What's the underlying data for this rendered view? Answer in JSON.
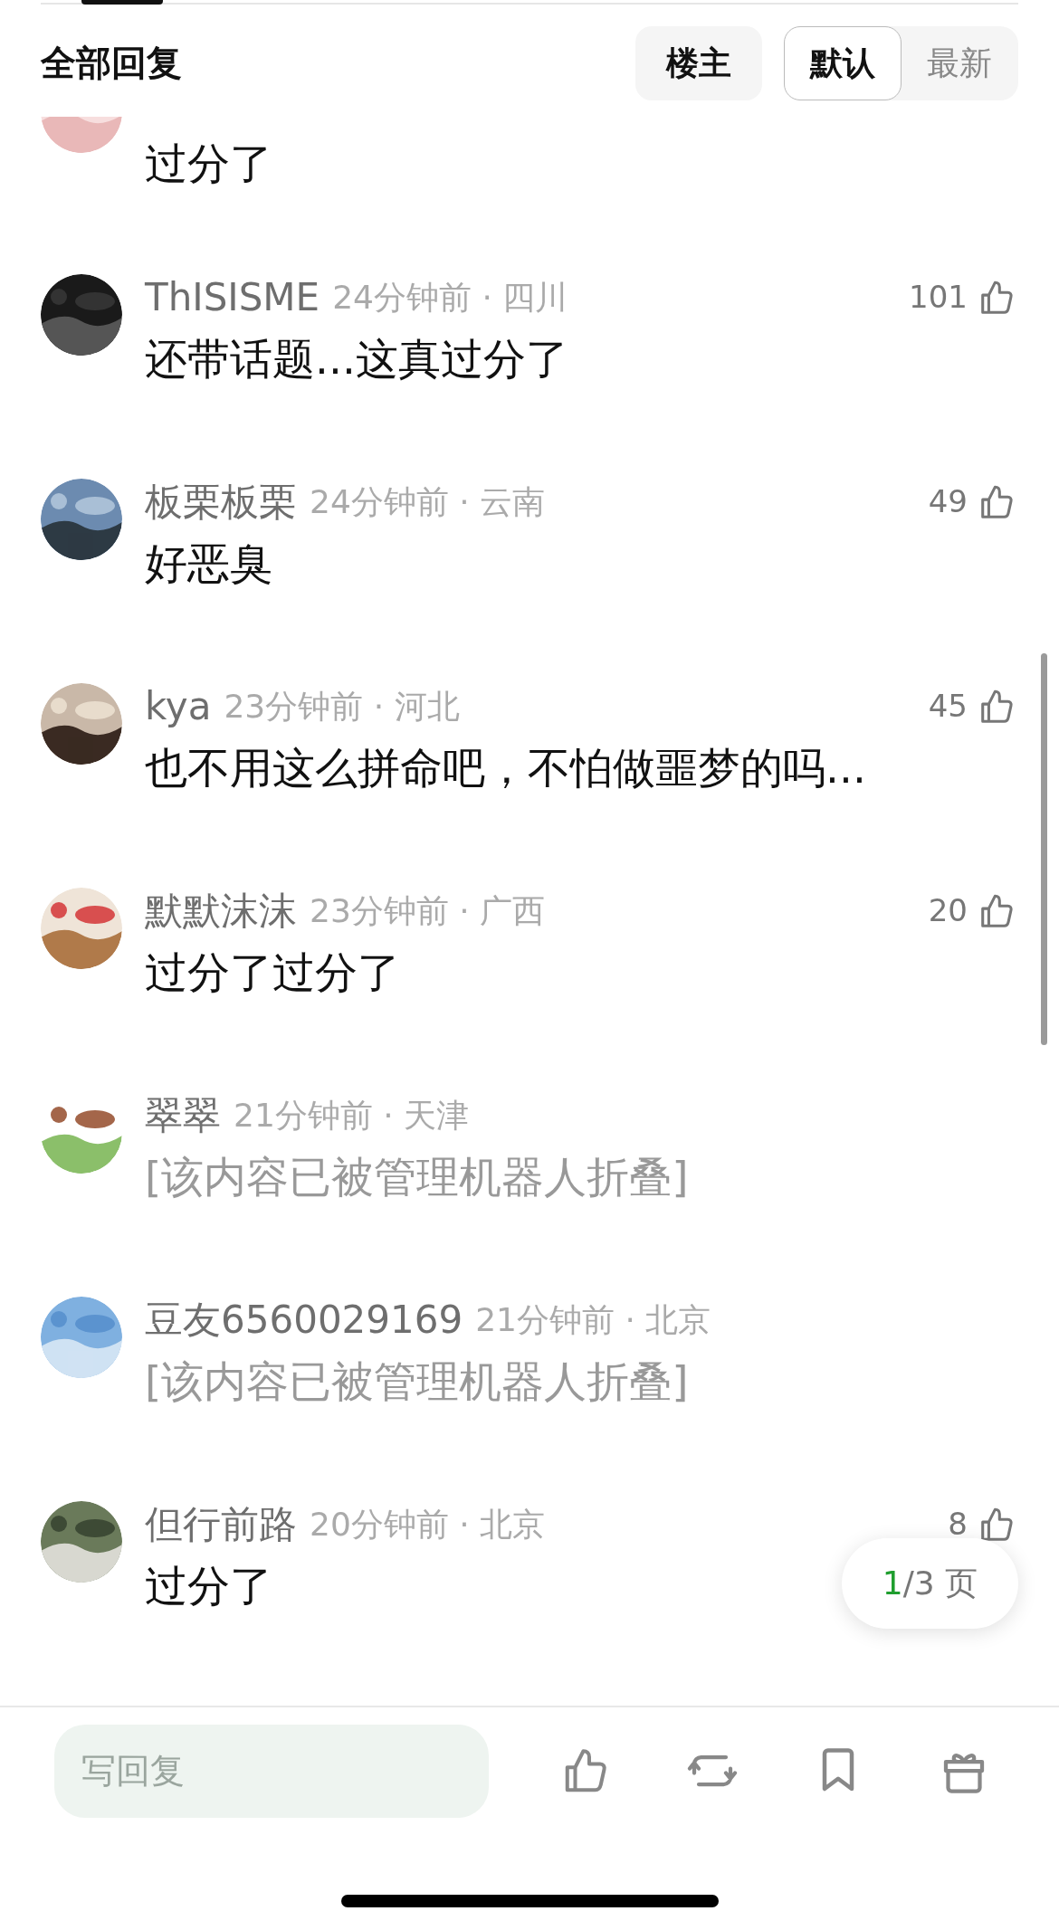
{
  "header": {
    "title": "全部回复",
    "filter_button": {
      "label": "楼主",
      "selected": false
    },
    "sort_tabs": [
      {
        "label": "默认",
        "selected": true
      },
      {
        "label": "最新",
        "selected": false
      }
    ]
  },
  "top_cut_comment": {
    "text": "过分了"
  },
  "comments": [
    {
      "name": "ThISISME",
      "meta": "24分钟前 · 四川",
      "text": "还带话题...这真过分了",
      "likes": "101",
      "folded": false
    },
    {
      "name": "板栗板栗",
      "meta": "24分钟前 · 云南",
      "text": "好恶臭",
      "likes": "49",
      "folded": false
    },
    {
      "name": "kya",
      "meta": "23分钟前 · 河北",
      "text": "也不用这么拼命吧，不怕做噩梦的吗...",
      "likes": "45",
      "folded": false
    },
    {
      "name": "默默沫沫",
      "meta": "23分钟前 · 广西",
      "text": "过分了过分了",
      "likes": "20",
      "folded": false
    },
    {
      "name": "翠翠",
      "meta": "21分钟前 · 天津",
      "text": "[该内容已被管理机器人折叠]",
      "folded": true
    },
    {
      "name": "豆友6560029169",
      "meta": "21分钟前 · 北京",
      "text": "[该内容已被管理机器人折叠]",
      "folded": true
    },
    {
      "name": "但行前路",
      "meta": "20分钟前 · 北京",
      "text": "过分了",
      "likes": "8",
      "folded": false
    }
  ],
  "pager": {
    "current": "1",
    "total": "/3 页"
  },
  "reply_bar": {
    "placeholder": "写回复"
  }
}
